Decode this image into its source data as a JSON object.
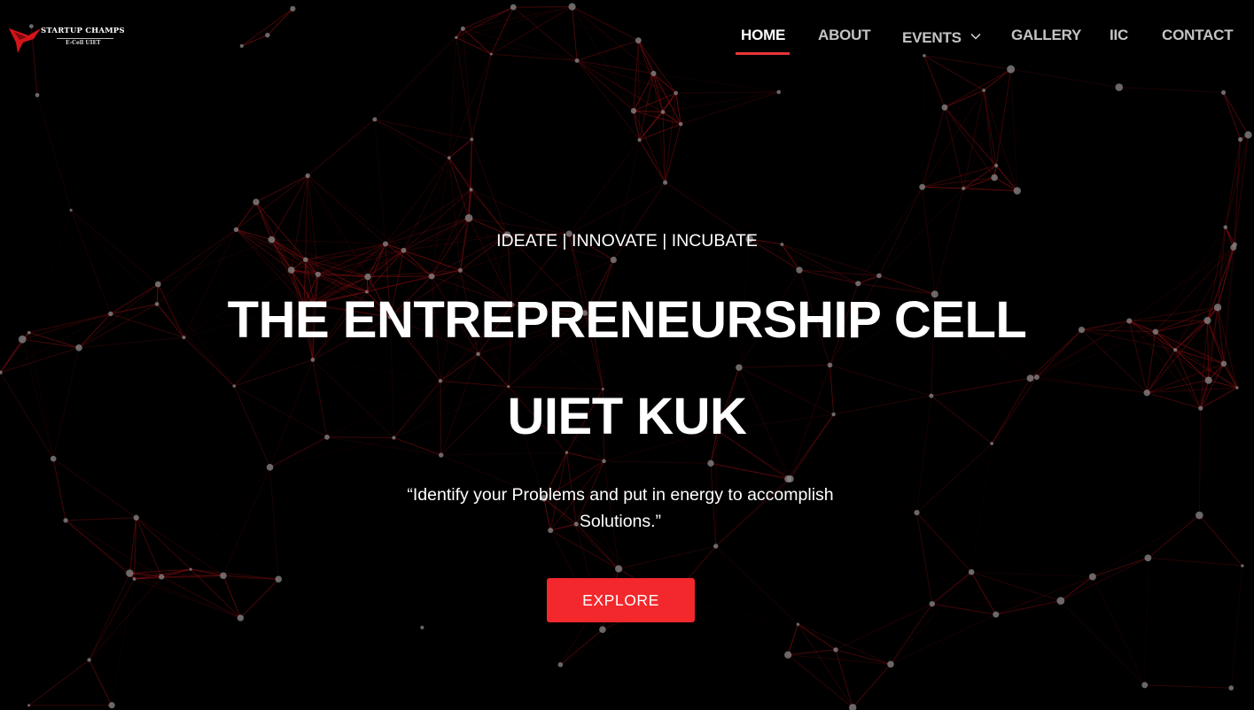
{
  "brand": {
    "name": "STARTUP CHAMPS",
    "subtitle": "E-Cell UIET",
    "logo_icon": "red-bird-logo-icon"
  },
  "nav": {
    "items": [
      {
        "label": "HOME",
        "active": true
      },
      {
        "label": "ABOUT",
        "active": false
      },
      {
        "label": "EVENTS",
        "active": false,
        "has_dropdown": true
      },
      {
        "label": "GALLERY",
        "active": false
      },
      {
        "label": "IIC",
        "active": false
      },
      {
        "label": "CONTACT",
        "active": false
      }
    ]
  },
  "hero": {
    "tagline": "IDEATE | INNOVATE | INCUBATE",
    "title_line1": "THE ENTREPRENEURSHIP CELL",
    "title_line2": "UIET KUK",
    "quote": "“Identify your Problems and put in energy to accomplish Solutions.”",
    "cta_label": "EXPLORE"
  },
  "colors": {
    "background": "#000000",
    "accent": "#f2282d",
    "network_line": "#8b0f12",
    "network_node": "#8a8a8a",
    "nav_inactive": "#c4c4c4"
  }
}
